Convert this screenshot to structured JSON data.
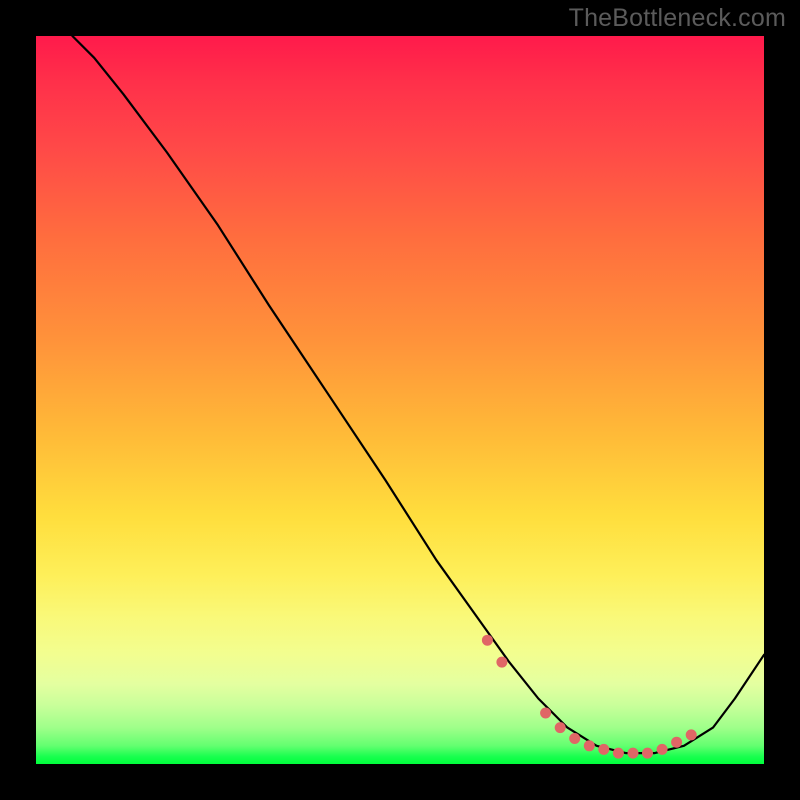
{
  "watermark": "TheBottleneck.com",
  "chart_data": {
    "type": "line",
    "title": "",
    "xlabel": "",
    "ylabel": "",
    "xlim": [
      0,
      100
    ],
    "ylim": [
      0,
      100
    ],
    "grid": false,
    "legend": false,
    "curve": {
      "x": [
        5,
        8,
        12,
        18,
        25,
        32,
        40,
        48,
        55,
        60,
        65,
        69,
        73,
        77,
        81,
        85,
        89,
        93,
        96,
        100
      ],
      "y": [
        100,
        97,
        92,
        84,
        74,
        63,
        51,
        39,
        28,
        21,
        14,
        9,
        5,
        2.5,
        1.5,
        1.5,
        2.5,
        5,
        9,
        15
      ]
    },
    "markers": {
      "x": [
        62,
        64,
        70,
        72,
        74,
        76,
        78,
        80,
        82,
        84,
        86,
        88,
        90
      ],
      "y": [
        17,
        14,
        7,
        5,
        3.5,
        2.5,
        2,
        1.5,
        1.5,
        1.5,
        2,
        3,
        4
      ],
      "color": "#e06666",
      "size": 5
    },
    "background_gradient": {
      "direction": "vertical",
      "stops": [
        {
          "pos": 0,
          "color": "#ff1a4b"
        },
        {
          "pos": 0.42,
          "color": "#ff933a"
        },
        {
          "pos": 0.74,
          "color": "#feef59"
        },
        {
          "pos": 0.92,
          "color": "#c8ff9a"
        },
        {
          "pos": 1.0,
          "color": "#00ff3c"
        }
      ]
    }
  }
}
